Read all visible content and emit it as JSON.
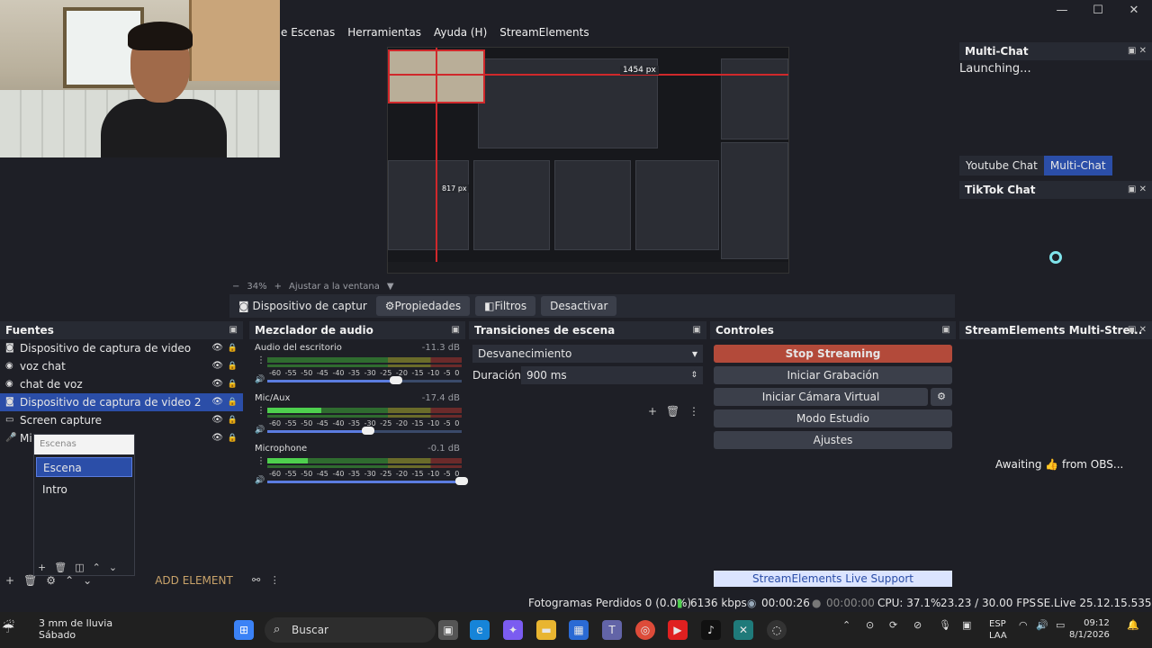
{
  "menu": [
    "e Escenas",
    "Herramientas",
    "Ayuda (H)",
    "StreamElements"
  ],
  "window_controls": [
    "—",
    "☐",
    "✕"
  ],
  "preview": {
    "measure_top": "1454 px",
    "measure_left": "817 px"
  },
  "zoom": {
    "minus": "−",
    "value": "34%",
    "plus": "+",
    "fit": "Ajustar a la ventana",
    "arrow": "▼"
  },
  "source_toolbar": {
    "source": "Dispositivo de captur",
    "properties": "Propiedades",
    "filters": "Filtros",
    "deactivate": "Desactivar"
  },
  "fuentes": {
    "title": "Fuentes",
    "items": [
      {
        "label": "Dispositivo de captura de video",
        "selected": false,
        "icon": "camera-icon"
      },
      {
        "label": "voz chat",
        "selected": false,
        "icon": "globe-icon"
      },
      {
        "label": "chat de voz",
        "selected": false,
        "icon": "globe-icon"
      },
      {
        "label": "Dispositivo de captura de video 2",
        "selected": true,
        "icon": "camera-icon"
      },
      {
        "label": "Screen capture",
        "selected": false,
        "icon": "monitor-icon"
      },
      {
        "label": "Mi",
        "selected": false,
        "icon": "mic-icon"
      }
    ]
  },
  "scene_popup": {
    "header": "Escenas",
    "items": [
      {
        "label": "Escena",
        "selected": true
      },
      {
        "label": "Intro",
        "selected": false
      }
    ]
  },
  "add_element": "ADD ELEMENT",
  "mixer": {
    "title": "Mezclador de audio",
    "ticks": "-60 -55 -50 -45 -40 -35 -30 -25 -20 -15 -10 -5 0",
    "channels": [
      {
        "name": "Audio del escritorio",
        "db": "-11.3 dB",
        "level": 0.0,
        "volume": 0.66
      },
      {
        "name": "Mic/Aux",
        "db": "-17.4 dB",
        "level": 0.28,
        "volume": 0.52
      },
      {
        "name": "Microphone",
        "db": "-0.1 dB",
        "level": 0.21,
        "volume": 1.0
      }
    ]
  },
  "transitions": {
    "title": "Transiciones de escena",
    "selected": "Desvanecimiento",
    "duration_label": "Duración",
    "duration_value": "900 ms"
  },
  "controls": {
    "title": "Controles",
    "buttons": [
      "Stop Streaming",
      "Iniciar Grabación",
      "Iniciar Cámara Virtual",
      "Modo Estudio",
      "Ajustes"
    ],
    "support": "StreamElements Live Support"
  },
  "multichat": {
    "title": "Multi-Chat",
    "status": "Launching...",
    "tabs": [
      {
        "label": "Youtube Chat",
        "active": false
      },
      {
        "label": "Multi-Chat",
        "active": true
      }
    ]
  },
  "tiktok": {
    "title": "TikTok Chat"
  },
  "se_multistream": {
    "title": "StreamElements Multi-Stre...",
    "awaiting": "Awaiting 👍 from OBS..."
  },
  "status_bar": {
    "frames": "Fotogramas Perdidos 0 (0.0%)",
    "kbps": "6136 kbps",
    "live_time": "00:00:26",
    "rec_time": "00:00:00",
    "cpu": "CPU: 37.1%",
    "fps": "23.23 / 30.00 FPS",
    "version": "SE.Live 25.12.15.535"
  },
  "taskbar": {
    "weather_line1": "3 mm de lluvia",
    "weather_line2": "Sábado",
    "search": "Buscar",
    "lang1": "ESP",
    "lang2": "LAA",
    "time": "09:12",
    "date": "8/1/2026"
  }
}
